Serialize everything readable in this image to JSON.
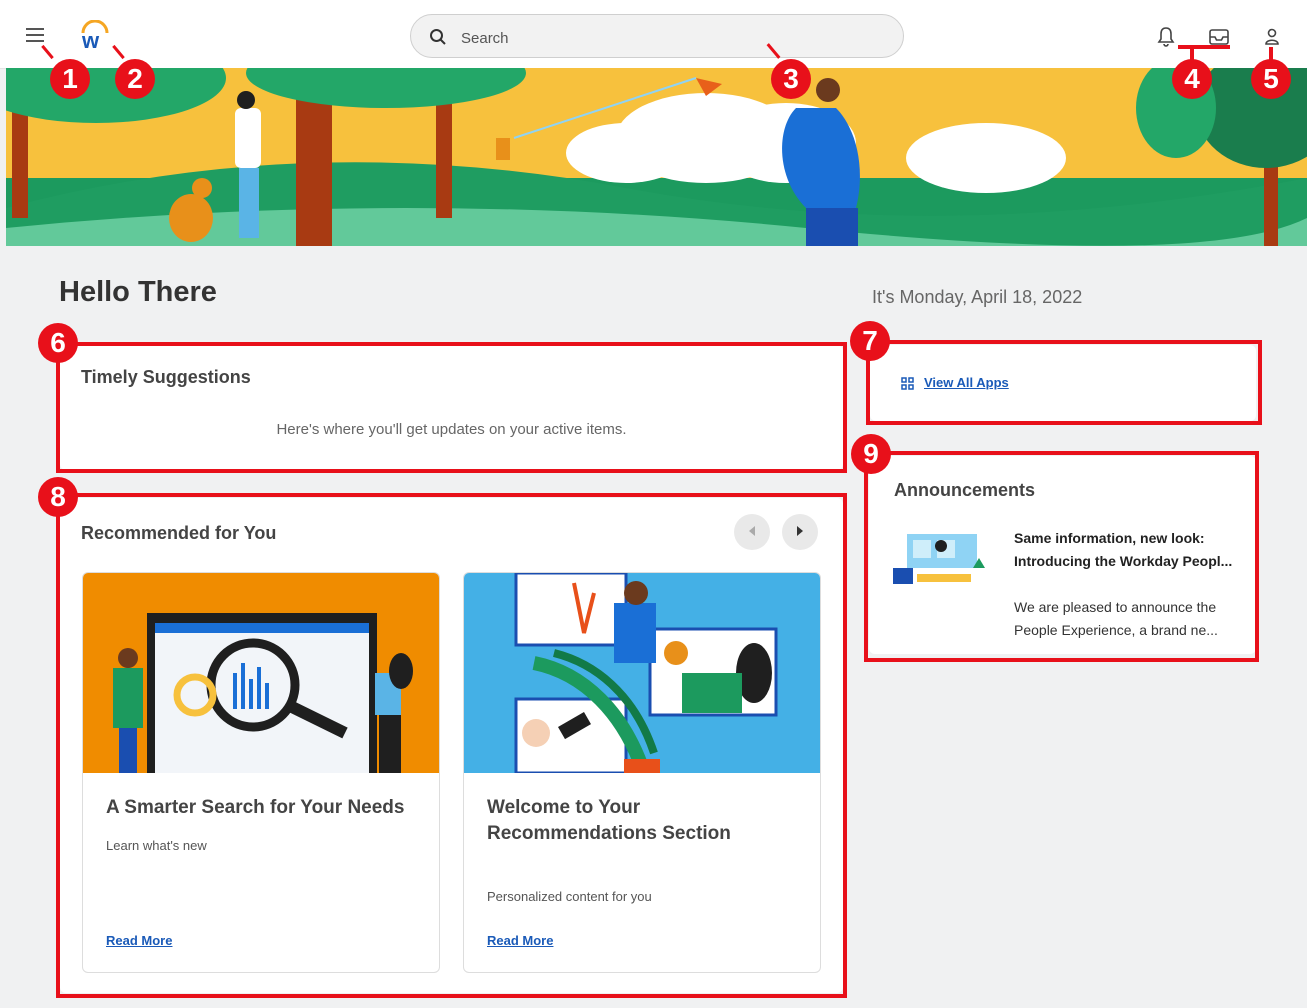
{
  "search": {
    "placeholder": "Search"
  },
  "greeting": "Hello There",
  "date_text": "It's Monday, April 18, 2022",
  "timely": {
    "title": "Timely Suggestions",
    "empty_text": "Here's where you'll get updates on your active items."
  },
  "apps": {
    "link_label": "View All Apps"
  },
  "recommended": {
    "title": "Recommended for You",
    "cards": [
      {
        "title": "A Smarter Search for Your Needs",
        "subtitle": "Learn what's new",
        "link": "Read More"
      },
      {
        "title": "Welcome to Your Recommendations Section",
        "subtitle": "Personalized content for you",
        "link": "Read More"
      }
    ]
  },
  "announcements": {
    "title": "Announcements",
    "headline": "Same information, new look: Introducing the Workday Peopl...",
    "body": "We are pleased to announce the People Experience, a brand ne..."
  },
  "callouts": [
    "1",
    "2",
    "3",
    "4",
    "5",
    "6",
    "7",
    "8",
    "9"
  ],
  "icons": [
    "menu-icon",
    "workday-logo",
    "search-icon",
    "bell-icon",
    "inbox-icon",
    "profile-icon",
    "apps-grid-icon",
    "chevron-left-icon",
    "chevron-right-icon"
  ],
  "colors": {
    "callout_red": "#e8101a",
    "link_blue": "#1a5ab8",
    "logo_orange": "#f5a623",
    "banner_green": "#1c9a5e",
    "banner_yellow": "#f7c13d"
  }
}
